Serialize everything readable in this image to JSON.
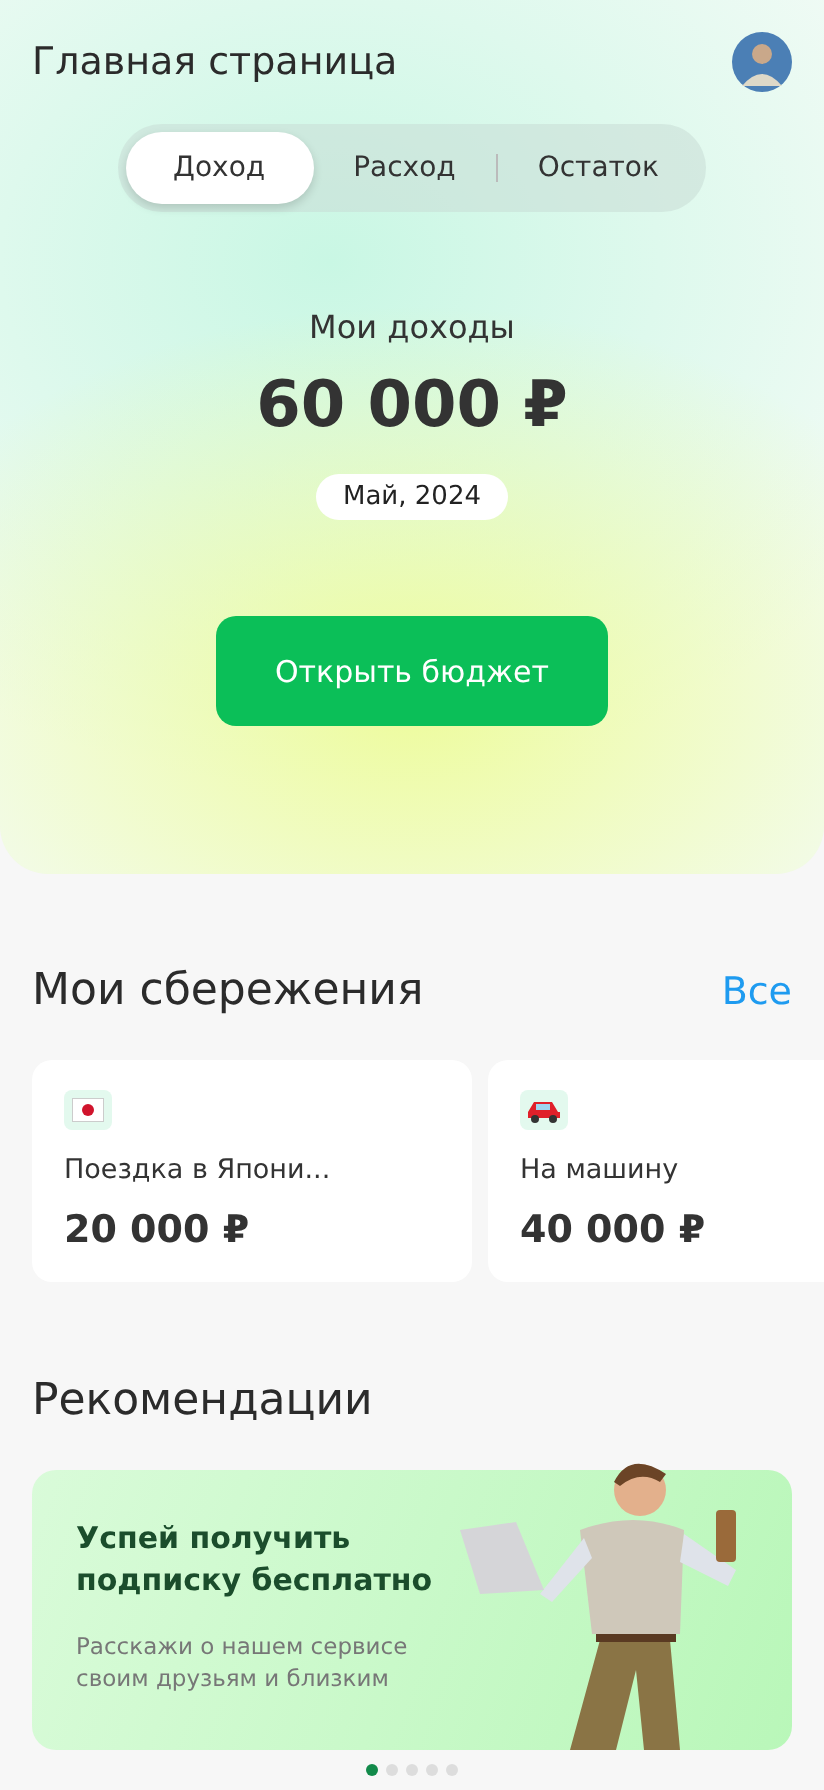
{
  "header": {
    "title": "Главная страница"
  },
  "tabs": [
    {
      "label": "Доход",
      "selected": true
    },
    {
      "label": "Расход",
      "selected": false
    },
    {
      "label": "Остаток",
      "selected": false
    }
  ],
  "summary": {
    "caption": "Мои доходы",
    "amount": "60 000 ₽",
    "period": "Май, 2024",
    "button": "Открыть бюджет"
  },
  "savings": {
    "title": "Мои сбережения",
    "link": "Все",
    "items": [
      {
        "kind": "flag",
        "name": "Поездка в Япони...",
        "amount": "20 000 ₽"
      },
      {
        "kind": "car",
        "name": "На машину",
        "amount": "40 000 ₽"
      }
    ]
  },
  "recommendations": {
    "title": "Рекомендации",
    "banner": {
      "kind": "picture",
      "heading": "Успей получить подписку бесплатно",
      "text": "Расскажи о нашем сервисе своим друзьям и близким"
    },
    "dots": [
      {
        "selected": true
      },
      {
        "selected": false
      },
      {
        "selected": false
      },
      {
        "selected": false
      },
      {
        "selected": false
      }
    ]
  }
}
